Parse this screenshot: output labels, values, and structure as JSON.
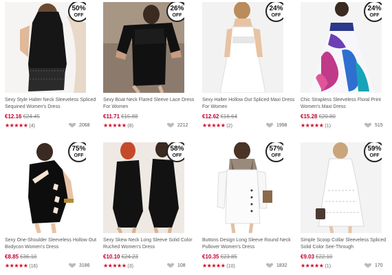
{
  "products": [
    {
      "discount": "50%",
      "off_label": "OFF",
      "name": "Sexy Style Halter Neck Sleeveless Spliced Sequined Women's Dress",
      "price": "€12.16",
      "old_price": "€24.45",
      "stars": "★★★★★",
      "reviews": "(4)",
      "likes": "2068",
      "image": "black-halter-sequin-dress"
    },
    {
      "discount": "26%",
      "off_label": "OFF",
      "name": "Sexy Boat Neck Flared Sleeve Lace Dress For Women",
      "price": "€11.71",
      "old_price": "€15.88",
      "stars": "★★★★★",
      "reviews": "(8)",
      "likes": "2212",
      "image": "black-lace-boat-neck-dress"
    },
    {
      "discount": "24%",
      "off_label": "OFF",
      "name": "Sexy Halter Hollow Out Spliced Maxi Dress For Women",
      "price": "€12.62",
      "old_price": "€16.64",
      "stars": "★★★★★",
      "reviews": "(2)",
      "likes": "1998",
      "image": "white-halter-maxi-dress"
    },
    {
      "discount": "24%",
      "off_label": "OFF",
      "name": "Chic Strapless Sleeveless Floral Print Women's Maxi Dress",
      "price": "€15.28",
      "old_price": "€20.80",
      "stars": "★★★★★",
      "reviews": "(1)",
      "likes": "515",
      "image": "floral-strapless-maxi-dress"
    },
    {
      "discount": "75%",
      "off_label": "OFF",
      "name": "Sexy One-Shoulder Sleeveless Hollow Out Bodycon Women's Dress",
      "price": "€8.85",
      "old_price": "€36.10",
      "stars": "★★★★★",
      "reviews": "(16)",
      "likes": "3186",
      "image": "black-one-shoulder-cutout-dress"
    },
    {
      "discount": "58%",
      "off_label": "OFF",
      "name": "Sexy Skew Neck Long Sleeve Solid Color Ruched Women's Dress",
      "price": "€10.10",
      "old_price": "€24.23",
      "stars": "★★★★★",
      "reviews": "(3)",
      "likes": "108",
      "image": "black-skew-neck-long-sleeve-dress"
    },
    {
      "discount": "57%",
      "off_label": "OFF",
      "name": "Buttons Design Long Sleeve Round Neck Pullover Women's Dress",
      "price": "€10.35",
      "old_price": "€23.85",
      "stars": "★★★★★",
      "reviews": "(10)",
      "likes": "1832",
      "image": "white-buttoned-long-sleeve-dress"
    },
    {
      "discount": "59%",
      "off_label": "OFF",
      "name": "Simple Scoop Collar Sleeveless Spliced Solid Color See-Through",
      "price": "€9.03",
      "old_price": "€22.10",
      "stars": "★★★★★",
      "reviews": "(1)",
      "likes": "170",
      "image": "white-lace-scoop-dress"
    }
  ],
  "colors": {
    "price": "#c0002f",
    "stars": "#d40022",
    "badge_border": "#222222"
  }
}
